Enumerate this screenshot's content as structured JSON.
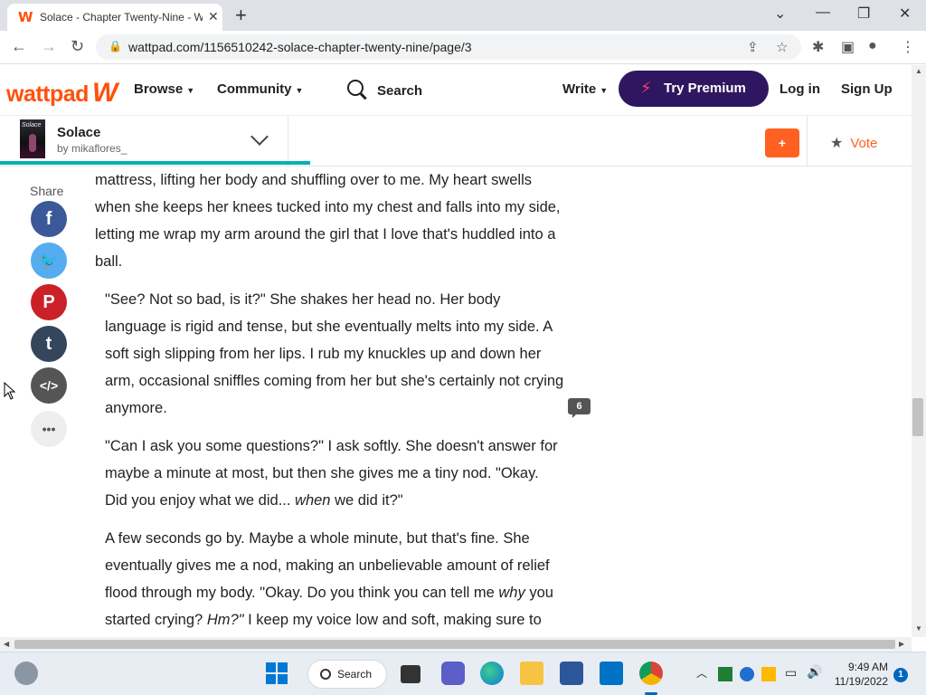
{
  "browser": {
    "tab_title": "Solace - Chapter Twenty-Nine - Wattpad",
    "tab_close": "✕",
    "new_tab": "+",
    "url": "wattpad.com/1156510242-solace-chapter-twenty-nine/page/3",
    "window_controls": {
      "minimize": "—",
      "maximize": "❐",
      "close": "✕",
      "tabsearch": "⌄"
    }
  },
  "header": {
    "logo": "wattpad",
    "nav": {
      "browse": "Browse",
      "community": "Community",
      "write": "Write"
    },
    "search_label": "Search",
    "premium_label": "Try Premium",
    "login": "Log in",
    "signup": "Sign Up"
  },
  "story": {
    "cover_text": "Solace",
    "title": "Solace",
    "author": "by mikaflores_",
    "progress_percent": 34,
    "add_label": "+",
    "vote_label": "Vote"
  },
  "share": {
    "label": "Share",
    "buttons": [
      {
        "icon": "facebook-icon",
        "glyph": "f",
        "color": "#3b5998"
      },
      {
        "icon": "twitter-icon",
        "glyph": "🐦",
        "color": "#55acee"
      },
      {
        "icon": "pinterest-icon",
        "glyph": "P",
        "color": "#cb2027"
      },
      {
        "icon": "tumblr-icon",
        "glyph": "t",
        "color": "#35465c"
      },
      {
        "icon": "embed-icon",
        "glyph": "</>",
        "color": "#555555"
      },
      {
        "icon": "more-icon",
        "glyph": "•••",
        "color": "#eeeeee"
      }
    ]
  },
  "reader": {
    "p1": "mattress, lifting her body and shuffling over to me. My heart swells when she keeps her knees tucked into my chest and falls into my side, letting me wrap my arm around the girl that I love that's huddled into a ball.",
    "p2": "\"See? Not so bad, is it?\" She shakes her head no. Her body language is rigid and tense, but she eventually melts into my side. A soft sigh slipping from her lips. I rub my knuckles up and down her arm, occasional sniffles coming from her but she's certainly not crying anymore.",
    "p3_a": "\"Can I ask you some questions?\" I ask softly. She doesn't answer for maybe a minute at most, but then she gives me a tiny nod. \"Okay. Did you enjoy what we did... ",
    "p3_em": "when",
    "p3_b": " we did it?\"",
    "p4_a": "A few seconds go by. Maybe a whole minute, but that's fine. She eventually gives me a nod, making an unbelievable amount of relief flood through my body. \"Okay. Do you think you can tell me ",
    "p4_em1": "why",
    "p4_b": " you started crying? ",
    "p4_em2": "Hm?\"",
    "p4_c": " I keep my voice low and soft, making sure to",
    "comment_count": "6"
  },
  "taskbar": {
    "search_label": "Search",
    "time": "9:49 AM",
    "date": "11/19/2022",
    "notifications": "1"
  }
}
